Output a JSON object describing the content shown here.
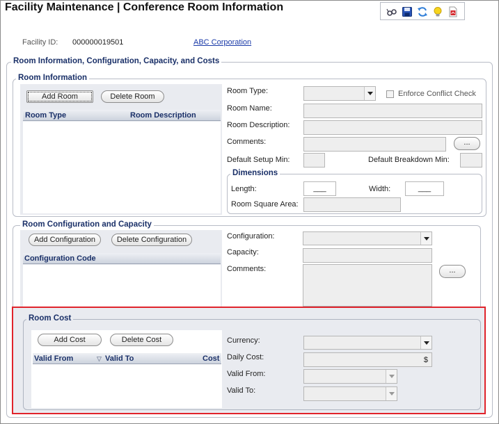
{
  "header": {
    "title": "Facility Maintenance | Conference Room Information"
  },
  "toolbar": {
    "icons": [
      "spectacles-icon",
      "save-icon",
      "refresh-icon",
      "lightbulb-icon",
      "pdf-icon"
    ]
  },
  "facility": {
    "id_label": "Facility ID:",
    "id_value": "000000019501",
    "company_link": "ABC Corporation"
  },
  "main_section": {
    "legend": "Room Information, Configuration, Capacity,  and Costs"
  },
  "room_info": {
    "legend": "Room Information",
    "add_button": "Add Room",
    "delete_button": "Delete Room",
    "grid_headers": [
      "Room Type",
      "Room Description"
    ],
    "room_type_label": "Room Type:",
    "enforce_label": "Enforce Conflict Check",
    "room_name_label": "Room Name:",
    "room_description_label": "Room Description:",
    "comments_label": "Comments:",
    "default_setup_label": "Default Setup Min:",
    "default_breakdown_label": "Default Breakdown Min:",
    "ellipsis": "..."
  },
  "dimensions": {
    "legend": "Dimensions",
    "length_label": "Length:",
    "length_value": "___",
    "width_label": "Width:",
    "width_value": "___",
    "area_label": "Room Square Area:"
  },
  "configuration": {
    "legend": "Room Configuration and Capacity",
    "add_button": "Add Configuration",
    "delete_button": "Delete Configuration",
    "grid_header": "Configuration Code",
    "config_label": "Configuration:",
    "capacity_label": "Capacity:",
    "comments_label": "Comments:",
    "ellipsis": "..."
  },
  "room_cost": {
    "legend": "Room Cost",
    "add_button": "Add Cost",
    "delete_button": "Delete Cost",
    "grid_headers": [
      "Valid From",
      "Valid To",
      "Cost"
    ],
    "currency_label": "Currency:",
    "daily_cost_label": "Daily Cost:",
    "daily_cost_symbol": "$",
    "valid_from_label": "Valid From:",
    "valid_to_label": "Valid To:"
  }
}
